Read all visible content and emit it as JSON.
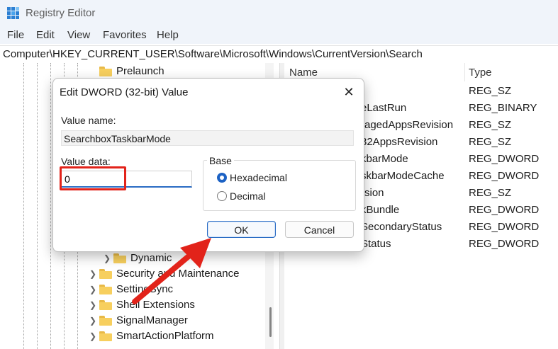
{
  "window": {
    "title": "Registry Editor"
  },
  "menu": [
    "File",
    "Edit",
    "View",
    "Favorites",
    "Help"
  ],
  "address": "Computer\\HKEY_CURRENT_USER\\Software\\Microsoft\\Windows\\CurrentVersion\\Search",
  "tree": {
    "items": [
      {
        "label": "Prelaunch"
      },
      {
        "label": "Dynamic"
      },
      {
        "label": "Security and Maintenance"
      },
      {
        "label": "SettingSync"
      },
      {
        "label": "Shell Extensions"
      },
      {
        "label": "SignalManager"
      },
      {
        "label": "SmartActionPlatform"
      }
    ]
  },
  "list": {
    "headers": {
      "name": "Name",
      "type": "Type"
    },
    "rows": [
      {
        "name": "",
        "type": "REG_SZ"
      },
      {
        "name": "eLastRun",
        "type": "REG_BINARY"
      },
      {
        "name": "ragedAppsRevision",
        "type": "REG_SZ"
      },
      {
        "name": "32AppsRevision",
        "type": "REG_SZ"
      },
      {
        "name": "kbarMode",
        "type": "REG_DWORD"
      },
      {
        "name": "skbarModeCache",
        "type": "REG_DWORD"
      },
      {
        "name": "rsion",
        "type": "REG_SZ"
      },
      {
        "name": "kBundle",
        "type": "REG_DWORD"
      },
      {
        "name": "SecondaryStatus",
        "type": "REG_DWORD"
      },
      {
        "name": "Status",
        "type": "REG_DWORD"
      }
    ]
  },
  "dialog": {
    "title": "Edit DWORD (32-bit) Value",
    "value_name_label": "Value name:",
    "value_name": "SearchboxTaskbarMode",
    "value_data_label": "Value data:",
    "value_data": "0",
    "base_label": "Base",
    "base_options": [
      {
        "label": "Hexadecimal",
        "checked": true
      },
      {
        "label": "Decimal",
        "checked": false
      }
    ],
    "ok_label": "OK",
    "cancel_label": "Cancel",
    "close_glyph": "✕"
  },
  "colors": {
    "accent": "#1c62c4",
    "annotation": "#e2231a",
    "folder": "#f7cf5e"
  },
  "icons": [
    "registry-editor-icon",
    "folder-icon",
    "chevron-right-icon",
    "close-icon"
  ]
}
